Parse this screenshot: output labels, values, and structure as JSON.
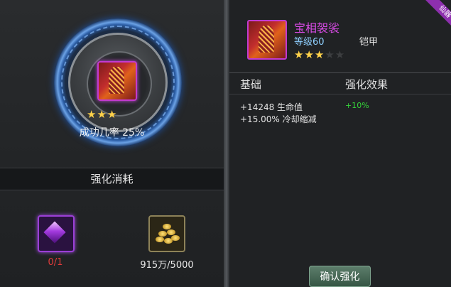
{
  "left": {
    "stars": "★★★",
    "success_rate": "成功几率 25%",
    "cost_title": "强化消耗",
    "materials": [
      {
        "icon": "purple-gem-icon",
        "count": "0/1"
      },
      {
        "icon": "gold-coins-icon",
        "count": "915万/5000"
      }
    ]
  },
  "item": {
    "name": "宝相袈裟",
    "level": "等级60",
    "type": "铠甲",
    "stars_filled": "★★★",
    "stars_empty": "★★",
    "ribbon": "仙器"
  },
  "stats": {
    "header_base": "基础",
    "header_effect": "强化效果",
    "lines": [
      "+14248 生命值",
      "+15.00% 冷却缩减"
    ],
    "bonus": "+10%"
  },
  "confirm_label": "确认强化",
  "colors": {
    "quality": "#d94be6",
    "bonus": "#35d43a",
    "insufficient": "#e03b3b"
  }
}
